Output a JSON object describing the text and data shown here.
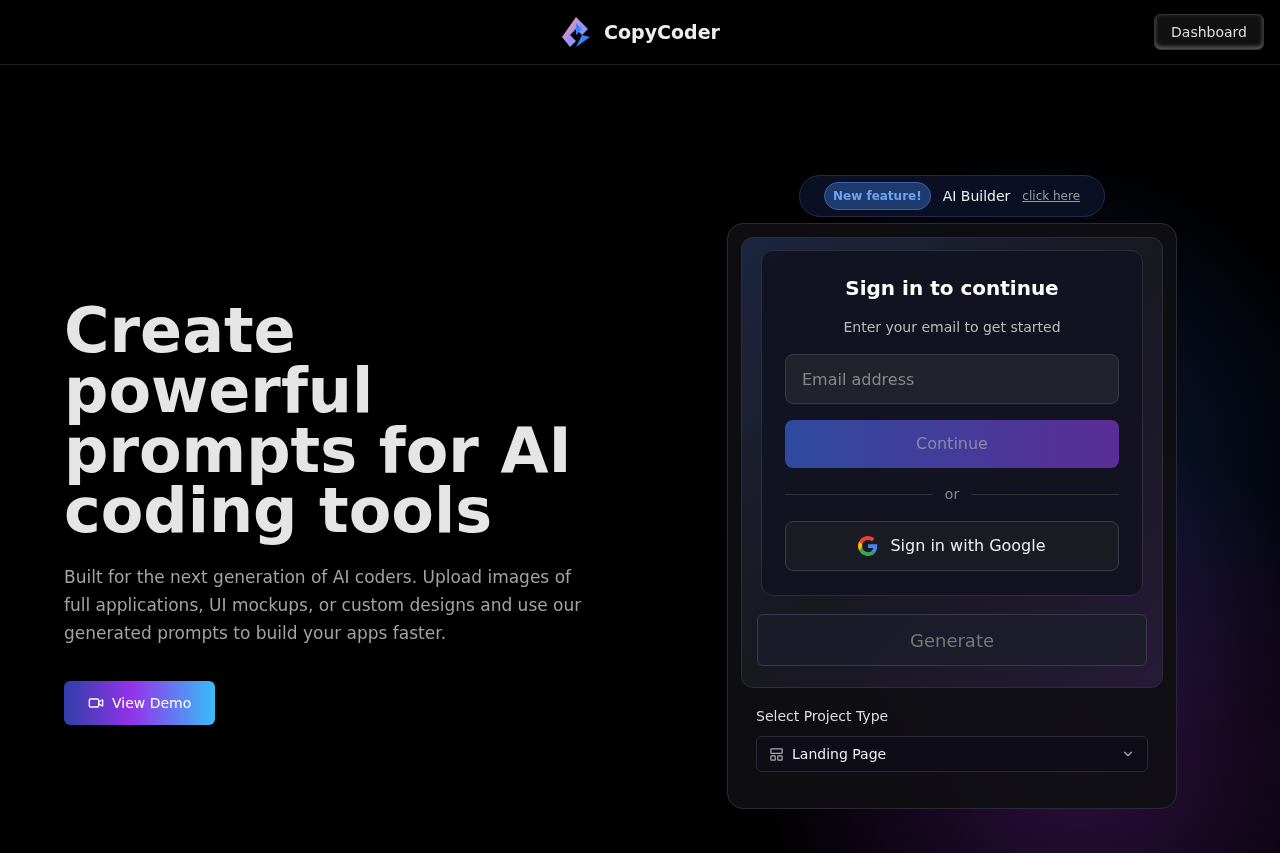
{
  "header": {
    "brand": "CopyCoder",
    "dashboard_button": "Dashboard"
  },
  "hero": {
    "title": "Create powerful prompts for AI coding tools",
    "description": "Built for the next generation of AI coders. Upload images of full applications, UI mockups, or custom designs and use our generated prompts to build your apps faster.",
    "demo_button": "View Demo"
  },
  "announcement": {
    "badge": "New feature!",
    "text": "AI Builder",
    "link": "click here"
  },
  "sign_in": {
    "title": "Sign in to continue",
    "subtitle": "Enter your email to get started",
    "email": {
      "placeholder": "Email address"
    },
    "continue_button": {
      "label": "Continue",
      "disabled": true
    },
    "divider": "or",
    "google_button": "Sign in with Google"
  },
  "generate_button": {
    "label": "Generate",
    "disabled": true
  },
  "project_type": {
    "label": "Select Project Type",
    "value": "Landing Page"
  }
}
